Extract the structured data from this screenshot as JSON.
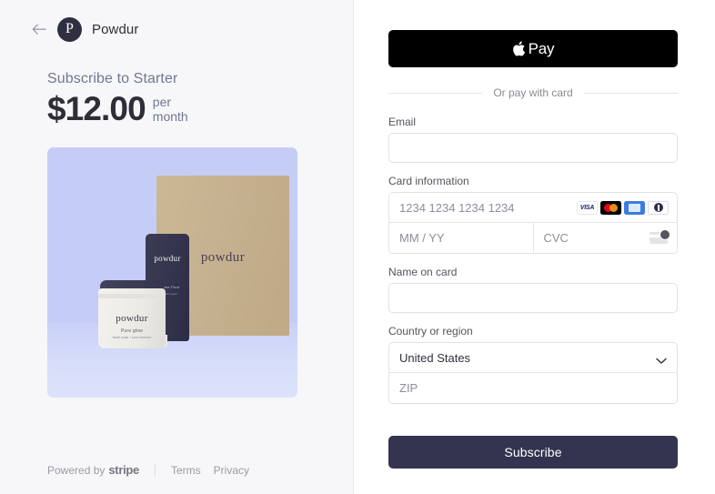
{
  "left": {
    "back_icon": "arrow-left-icon",
    "logo_letter": "P",
    "merchant_name": "Powdur",
    "subscribe_label": "Subscribe to Starter",
    "price_amount": "$12.00",
    "price_period_line1": "per",
    "price_period_line2": "month",
    "product_image": {
      "background_color": "#c5cdf7",
      "box_label": "powdur",
      "tube_label": "powdur",
      "tube_sub": "Extreme Pure",
      "tube_sub2": "for all skin types",
      "jar_label": "powdur",
      "jar_sub": "Pure glow",
      "jar_sub2": "facial mask + pore essence"
    },
    "footer": {
      "powered_by": "Powered by",
      "stripe": "stripe",
      "terms": "Terms",
      "privacy": "Privacy"
    }
  },
  "right": {
    "apple_pay_label": "Pay",
    "apple_icon": "apple-logo-icon",
    "or_divider_text": "Or pay with card",
    "email": {
      "label": "Email",
      "value": "",
      "placeholder": ""
    },
    "card": {
      "label": "Card information",
      "number_placeholder": "1234 1234 1234 1234",
      "number_value": "",
      "expiry_placeholder": "MM / YY",
      "expiry_value": "",
      "cvc_placeholder": "CVC",
      "cvc_value": "",
      "brands": [
        {
          "name": "visa-icon",
          "text": "VISA"
        },
        {
          "name": "mastercard-icon",
          "text": ""
        },
        {
          "name": "amex-icon",
          "text": "AMEX"
        },
        {
          "name": "diners-icon",
          "text": ""
        }
      ],
      "cvc_hint_icon": "cvc-card-icon"
    },
    "name_on_card": {
      "label": "Name on card",
      "value": "",
      "placeholder": ""
    },
    "country": {
      "label": "Country or region",
      "selected": "United States",
      "chevron_icon": "chevron-down-icon",
      "zip_placeholder": "ZIP",
      "zip_value": ""
    },
    "submit_label": "Subscribe",
    "accent_color": "#343450"
  }
}
